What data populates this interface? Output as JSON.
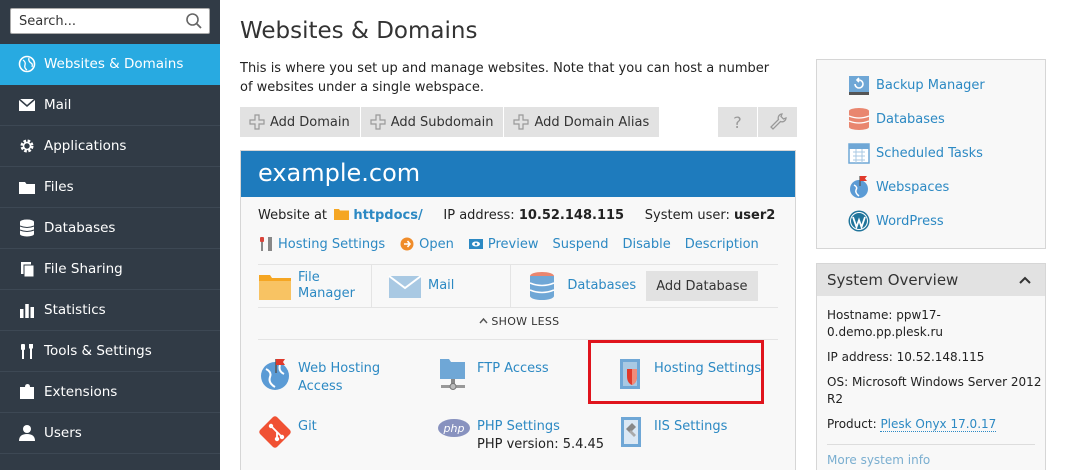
{
  "sidebar": {
    "search_placeholder": "Search...",
    "items": [
      {
        "label": "Websites & Domains",
        "icon": "globe-icon",
        "active": true
      },
      {
        "label": "Mail",
        "icon": "envelope-icon"
      },
      {
        "label": "Applications",
        "icon": "gear-icon"
      },
      {
        "label": "Files",
        "icon": "folder-icon"
      },
      {
        "label": "Databases",
        "icon": "database-icon"
      },
      {
        "label": "File Sharing",
        "icon": "file-sharing-icon"
      },
      {
        "label": "Statistics",
        "icon": "bar-chart-icon"
      },
      {
        "label": "Tools & Settings",
        "icon": "tools-icon"
      },
      {
        "label": "Extensions",
        "icon": "puzzle-icon"
      },
      {
        "label": "Users",
        "icon": "user-icon"
      }
    ]
  },
  "main": {
    "title": "Websites & Domains",
    "description": "This is where you set up and manage websites. Note that you can host a number of websites under a single webspace.",
    "toolbar": {
      "add_domain": "Add Domain",
      "add_subdomain": "Add Subdomain",
      "add_alias": "Add Domain Alias",
      "help": "?"
    }
  },
  "domain": {
    "name": "example.com",
    "website_at_label": "Website at",
    "docroot": "httpdocs/",
    "ip_label": "IP address:",
    "ip": "10.52.148.115",
    "sysuser_label": "System user:",
    "sysuser": "user2",
    "actions": {
      "hosting_settings": "Hosting Settings",
      "open": "Open",
      "preview": "Preview",
      "suspend": "Suspend",
      "disable": "Disable",
      "description": "Description"
    },
    "quick": {
      "file_manager_1": "File",
      "file_manager_2": "Manager",
      "mail": "Mail",
      "databases": "Databases",
      "add_database": "Add Database"
    },
    "show_less": "SHOW LESS",
    "tools": {
      "web_hosting_access_1": "Web Hosting",
      "web_hosting_access_2": "Access",
      "ftp_access": "FTP Access",
      "hosting_settings": "Hosting Settings",
      "git": "Git",
      "php_settings": "PHP Settings",
      "php_version": "PHP version: 5.4.45",
      "iis_settings": "IIS Settings"
    }
  },
  "right_panel": {
    "links": [
      "Backup Manager",
      "Databases",
      "Scheduled Tasks",
      "Webspaces",
      "WordPress"
    ],
    "system_overview": {
      "title": "System Overview",
      "hostname_label": "Hostname:",
      "hostname": "ppw17-0.demo.pp.plesk.ru",
      "ip_label": "IP address:",
      "ip": "10.52.148.115",
      "os_label": "OS:",
      "os": "Microsoft Windows Server 2012 R2",
      "product_label": "Product:",
      "product": "Plesk Onyx 17.0.17",
      "more": "More system info"
    }
  },
  "colors": {
    "sidebar_bg": "#313b46",
    "active_item": "#28aae1",
    "domain_header": "#1e7bbd",
    "link": "#2c89c3",
    "highlight": "#e0141d"
  }
}
